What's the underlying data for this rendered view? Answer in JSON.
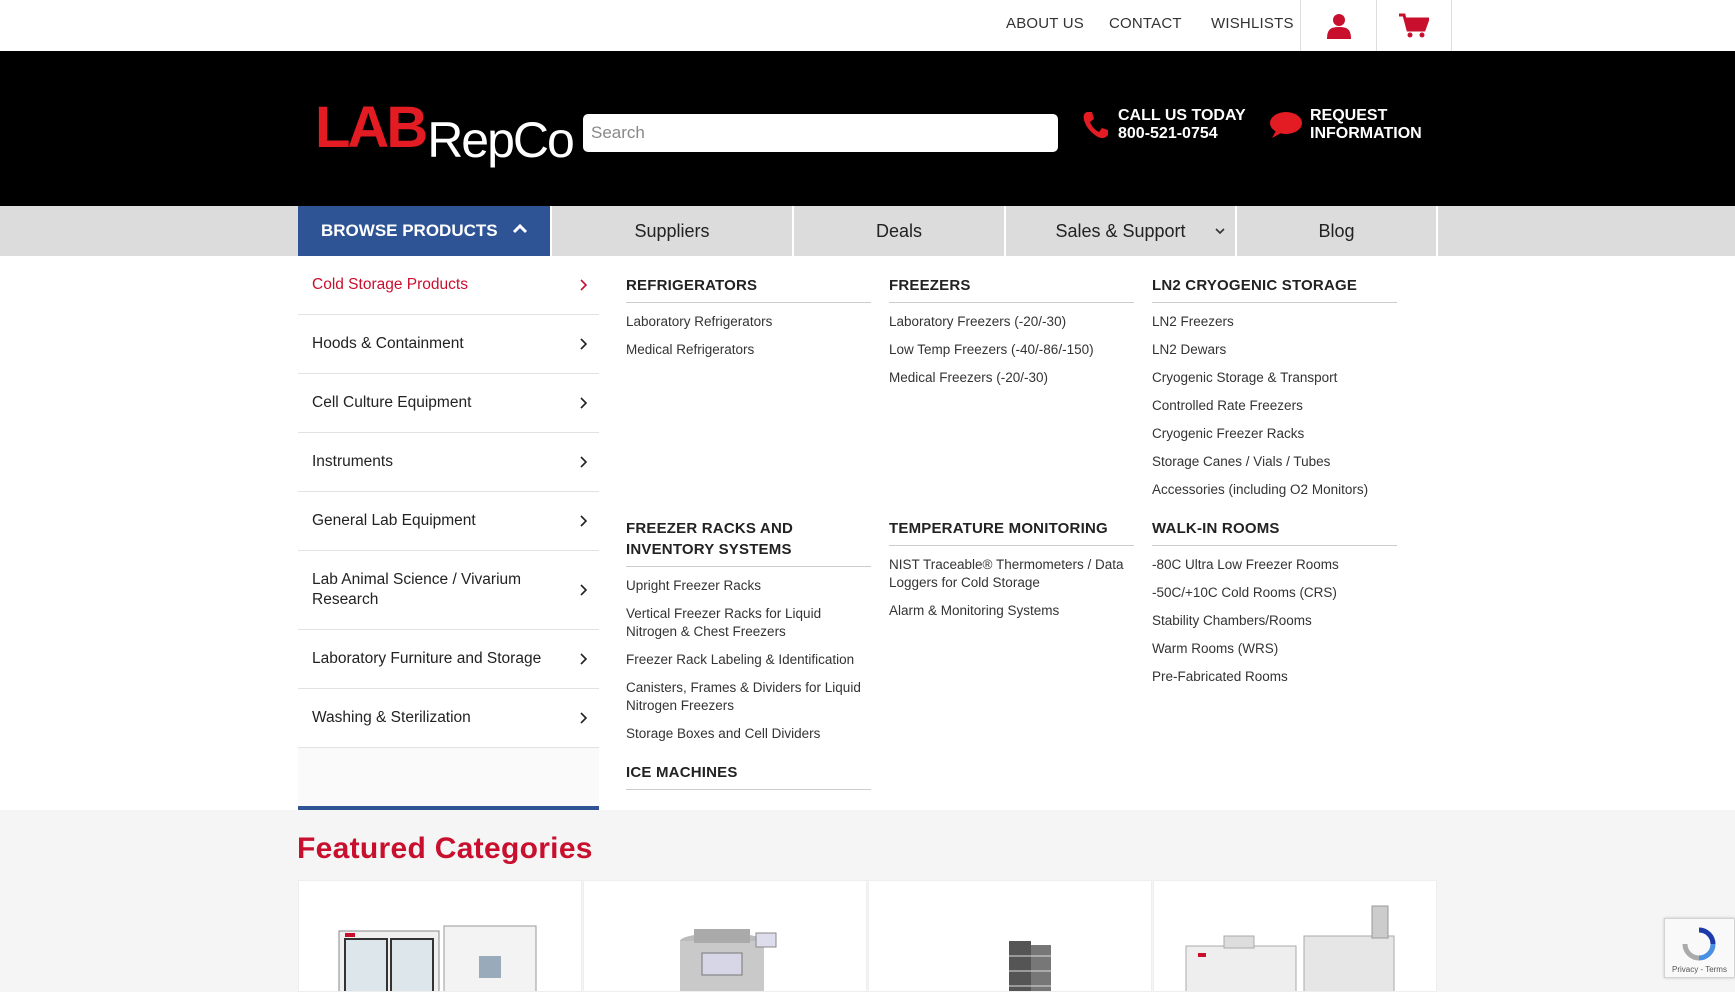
{
  "topbar": {
    "links": [
      "ABOUT US",
      "CONTACT",
      "WISHLISTS"
    ],
    "icons": [
      "account-icon",
      "cart-icon"
    ]
  },
  "header": {
    "logo_lab": "LAB",
    "logo_repco": "RepCo",
    "search_placeholder": "Search",
    "call_line1": "CALL US TODAY",
    "call_line2": "800-521-0754",
    "request_line1": "REQUEST",
    "request_line2": "INFORMATION"
  },
  "nav": {
    "browse": "BROWSE PRODUCTS",
    "items": [
      "Suppliers",
      "Deals",
      "Sales & Support",
      "Blog"
    ]
  },
  "categories": [
    "Cold Storage Products",
    "Hoods & Containment",
    "Cell Culture Equipment",
    "Instruments",
    "General Lab Equipment",
    "Lab Animal Science / Vivarium Research",
    "Laboratory Furniture and Storage",
    "Washing & Sterilization"
  ],
  "mega": {
    "refrigerators": {
      "title": "REFRIGERATORS",
      "items": [
        "Laboratory Refrigerators",
        "Medical Refrigerators"
      ]
    },
    "freezers": {
      "title": "FREEZERS",
      "items": [
        "Laboratory Freezers (-20/-30)",
        "Low Temp Freezers (-40/-86/-150)",
        "Medical Freezers (-20/-30)"
      ]
    },
    "ln2": {
      "title": "LN2 CRYOGENIC STORAGE",
      "items": [
        "LN2 Freezers",
        "LN2 Dewars",
        "Cryogenic Storage & Transport",
        "Controlled Rate Freezers",
        "Cryogenic Freezer Racks",
        "Storage Canes / Vials / Tubes",
        "Accessories (including O2 Monitors)"
      ]
    },
    "racks": {
      "title": "FREEZER RACKS AND INVENTORY SYSTEMS",
      "items": [
        "Upright Freezer Racks",
        "Vertical Freezer Racks for Liquid Nitrogen & Chest Freezers",
        "Freezer Rack Labeling & Identification",
        "Canisters, Frames & Dividers for Liquid Nitrogen Freezers",
        "Storage Boxes and Cell Dividers"
      ]
    },
    "temp": {
      "title": "TEMPERATURE MONITORING",
      "items": [
        "NIST Traceable® Thermometers / Data Loggers for Cold Storage",
        "Alarm & Monitoring Systems"
      ]
    },
    "walkin": {
      "title": "WALK-IN ROOMS",
      "items": [
        "-80C Ultra Low Freezer Rooms",
        "-50C/+10C Cold Rooms (CRS)",
        "Stability Chambers/Rooms",
        "Warm Rooms (WRS)",
        "Pre-Fabricated Rooms"
      ]
    },
    "ice": {
      "title": "ICE MACHINES"
    }
  },
  "featured": {
    "title": "Featured Categories"
  },
  "recaptcha": {
    "text": "Privacy - Terms"
  },
  "colors": {
    "brand_red": "#c8102e",
    "nav_blue": "#2f5496",
    "header_black": "#000000"
  }
}
